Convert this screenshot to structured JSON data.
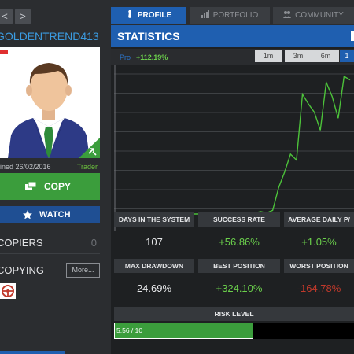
{
  "profile": {
    "username": "GOLDENTREND413",
    "joined": "ined 26/02/2016",
    "role": "Trader",
    "copiers_label": "COPIERS",
    "copiers_count": "0",
    "copying_label": "COPYING",
    "more_label": "More...",
    "copy_label": "COPY",
    "watch_label": "WATCH",
    "nav_prev": "<",
    "nav_next": ">"
  },
  "tabs": [
    {
      "label": "PROFILE",
      "active": true
    },
    {
      "label": "PORTFOLIO",
      "active": false
    },
    {
      "label": "COMMUNITY",
      "active": false
    }
  ],
  "statistics": {
    "title": "STATISTICS",
    "legend_name": "Pro",
    "legend_value": "+112.19%",
    "periods": [
      "1m",
      "3m",
      "6m",
      "1"
    ],
    "selected_period": "1"
  },
  "chart_data": {
    "type": "line",
    "series": [
      {
        "values": [
          0,
          0,
          0,
          0,
          0,
          0,
          0,
          0,
          0,
          0,
          0,
          0,
          0,
          0,
          0,
          0,
          0,
          0,
          0,
          0,
          0.5,
          1,
          2,
          1,
          3,
          22,
          35,
          50,
          45,
          100,
          92,
          85,
          70,
          110,
          98,
          80,
          115,
          112
        ]
      }
    ],
    "line_color": "#4cc23a",
    "grid": true
  },
  "stats": {
    "days_label": "DAYS IN THE SYSTEM",
    "days_value": "107",
    "success_label": "SUCCESS RATE",
    "success_value": "+56.86%",
    "avg_label": "AVERAGE DAILY P/",
    "avg_value": "+1.05%",
    "drawdown_label": "MAX DRAWDOWN",
    "drawdown_value": "24.69%",
    "best_label": "BEST POSITION",
    "best_value": "+324.10%",
    "worst_label": "WORST POSITION",
    "worst_value": "-164.78%"
  },
  "risk": {
    "label": "RISK LEVEL",
    "text": "5.56 / 10",
    "level": 0.556
  },
  "colors": {
    "accent_blue": "#1f5fb0",
    "positive_green": "#6bd04c",
    "negative_red": "#c0392b",
    "copy_green": "#3b9d3c"
  },
  "icons": [
    "chevron-left-icon",
    "chevron-right-icon",
    "flag-icon",
    "copy-icon",
    "star-eye-icon",
    "profile-tie-icon",
    "portfolio-chart-icon",
    "community-people-icon",
    "steering-wheel-icon"
  ]
}
